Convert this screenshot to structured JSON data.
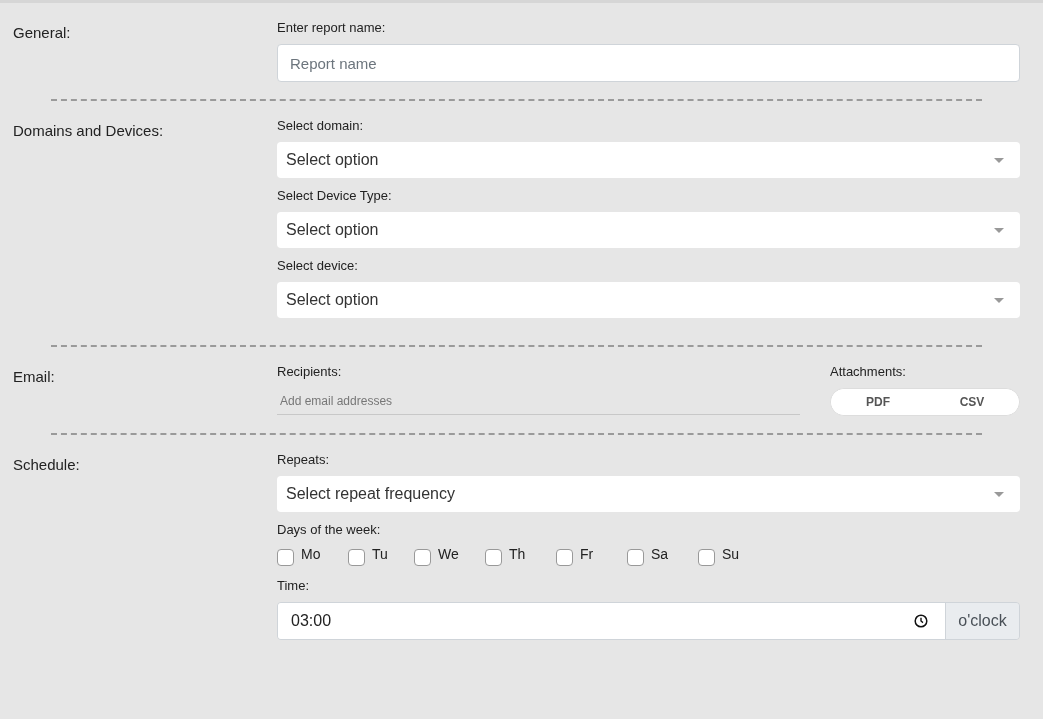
{
  "general": {
    "heading": "General:",
    "name_label": "Enter report name:",
    "name_placeholder": "Report name"
  },
  "domains": {
    "heading": "Domains and Devices:",
    "selects": [
      {
        "label": "Select domain:",
        "value": "Select option"
      },
      {
        "label": "Select Device Type:",
        "value": "Select option"
      },
      {
        "label": "Select device:",
        "value": "Select option"
      }
    ]
  },
  "email": {
    "heading": "Email:",
    "recipients_label": "Recipients:",
    "recipients_placeholder": "Add email addresses",
    "attachments_label": "Attachments:",
    "attachments": [
      {
        "label": "PDF",
        "selected": false
      },
      {
        "label": "CSV",
        "selected": false
      }
    ]
  },
  "schedule": {
    "heading": "Schedule:",
    "repeats_label": "Repeats:",
    "repeats_value": "Select repeat frequency",
    "days_label": "Days of the week:",
    "days": [
      {
        "label": "Mo",
        "checked": false
      },
      {
        "label": "Tu",
        "checked": false
      },
      {
        "label": "We",
        "checked": false
      },
      {
        "label": "Th",
        "checked": false
      },
      {
        "label": "Fr",
        "checked": false
      },
      {
        "label": "Sa",
        "checked": false
      },
      {
        "label": "Su",
        "checked": false
      }
    ],
    "time_label": "Time:",
    "time_value": "03:00",
    "time_unit": "o'clock"
  }
}
